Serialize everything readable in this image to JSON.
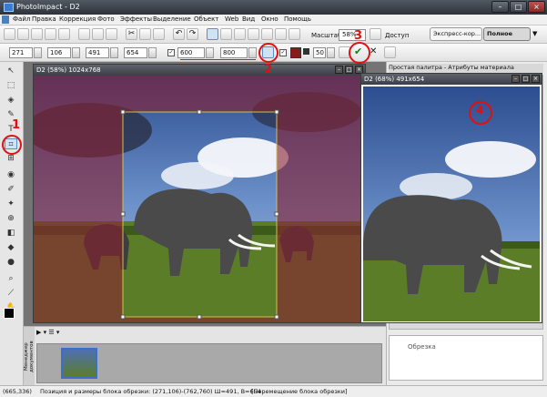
{
  "app": {
    "title": "PhotoImpact - D2"
  },
  "menu": [
    "Файл",
    "Правка",
    "Коррекция",
    "Фото",
    "Эффекты",
    "Выделение",
    "Объект",
    "Web",
    "Вид",
    "Окно",
    "Помощь"
  ],
  "toolbar1": {
    "zoom_label": "Масштаб",
    "zoom_value": "58%",
    "access_label": "Доступ",
    "mode_express": "Экспресс-кор...",
    "mode_full": "Полное ред..."
  },
  "toolbar2": {
    "x": "271",
    "y": "106",
    "w": "491",
    "h": "654",
    "fixed_w": "600",
    "fixed_h": "800",
    "opacity": "50"
  },
  "doc1": {
    "title": "D2 (58%) 1024x768"
  },
  "doc2": {
    "title": "D2 (68%) 491x654"
  },
  "right_panel": {
    "header": "Простая палитра - Атрибуты материала",
    "item": "Обрезка"
  },
  "bottom_panel": {
    "side_label": "Менеджер документов"
  },
  "annotations": {
    "m1": "1",
    "m2": "2",
    "m3": "3",
    "m4": "4"
  },
  "status": {
    "coords": "(665,336)",
    "message": "Позиция и размеры блока обрезки: (271,106)-(762,760) Ш=491, В=654",
    "hint": "[Перемещение блока обрезки]"
  },
  "colors": {
    "accent_red": "#e01010",
    "crop_mask": "#8b2030",
    "title_dark": "#3b3f45"
  }
}
